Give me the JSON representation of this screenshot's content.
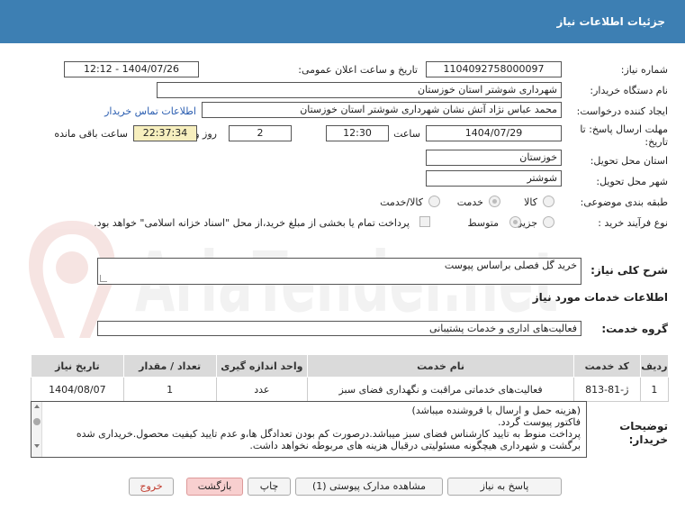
{
  "header": {
    "title": "جزئیات اطلاعات نیاز"
  },
  "fields": {
    "need_number_label": "شماره نیاز:",
    "need_number": "1104092758000097",
    "announce_label": "تاریخ و ساعت اعلان عمومی:",
    "announce_value": "1404/07/26 - 12:12",
    "buyer_org_label": "نام دستگاه خریدار:",
    "buyer_org": "شهرداری شوشتر استان خوزستان",
    "creator_label": "ایجاد کننده درخواست:",
    "creator": "محمد عباس نژاد آتش نشان شهرداری شوشتر استان خوزستان",
    "contact_link": "اطلاعات تماس خریدار",
    "deadline_label_line1": "مهلت ارسال پاسخ: تا",
    "deadline_label_line2": "تاریخ:",
    "deadline_date": "1404/07/29",
    "time_label": "ساعت",
    "deadline_time": "12:30",
    "days_value": "2",
    "days_label": "روز و",
    "remaining_time": "22:37:34",
    "remaining_label": "ساعت باقی مانده",
    "province_label": "استان محل تحویل:",
    "province": "خوزستان",
    "city_label": "شهر محل تحویل:",
    "city": "شوشتر",
    "category_label": "طبقه بندی موضوعی:",
    "category_options": [
      "کالا",
      "خدمت",
      "کالا/خدمت"
    ],
    "category_selected": "خدمت",
    "process_label": "نوع فرآیند خرید :",
    "process_options": [
      "جزیی",
      "متوسط"
    ],
    "process_selected": "متوسط",
    "payment_note": "پرداخت تمام یا بخشی از مبلغ خرید،از محل \"اسناد خزانه اسلامی\" خواهد بود."
  },
  "summary": {
    "label": "شرح کلی نیاز:",
    "value": "خرید گل فصلی براساس پیوست"
  },
  "services_heading": "اطلاعات خدمات مورد نیاز",
  "service_group": {
    "label": "گروه خدمت:",
    "value": "فعالیت‌های اداری و خدمات پشتیبانی"
  },
  "table": {
    "headers": [
      "ردیف",
      "کد خدمت",
      "نام خدمت",
      "واحد اندازه گیری",
      "تعداد / مقدار",
      "تاریخ نیاز"
    ],
    "rows": [
      [
        "1",
        "ژ-81-813",
        "فعالیت‌های خدماتی مراقبت و نگهداری فضای سبز",
        "عدد",
        "1",
        "1404/08/07"
      ]
    ]
  },
  "buyer_notes": {
    "label_line1": "توضیحات",
    "label_line2": "خریدار:",
    "lines": [
      "(هزینه حمل و ارسال با فروشنده میباشد)",
      "فاکتور پیوست گردد.",
      "پرداخت منوط به تایید کارشناس فضای سبز میباشد.درصورت کم بودن تعدادگل ها،و عدم تایید کیفیت محصول.خریداری شده",
      "برگشت و شهرداری هیچگونه مسئولیتی درقبال هزینه های مربوطه نخواهد داشت."
    ]
  },
  "buttons": {
    "reply": "پاسخ به نیاز",
    "attachments": "مشاهده مدارک پیوستی (1)",
    "print": "چاپ",
    "back": "بازگشت",
    "exit": "خروج"
  },
  "watermark": "AriaTender.net"
}
